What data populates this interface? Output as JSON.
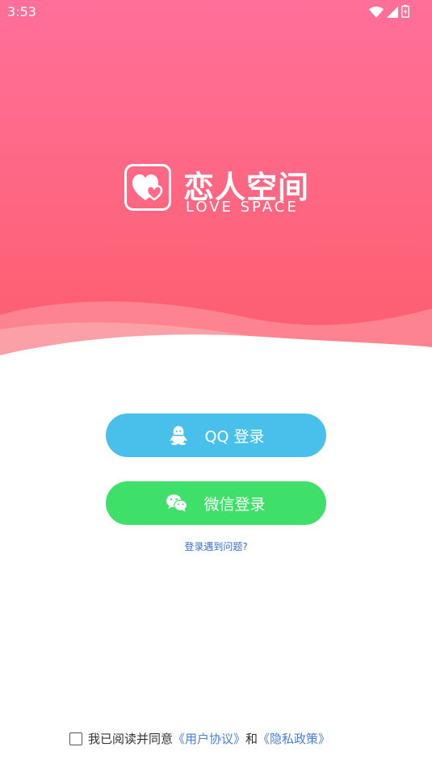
{
  "status_bar": {
    "time": "3:53",
    "icons": [
      "wifi-icon",
      "signal-icon",
      "battery-charging-icon"
    ]
  },
  "brand": {
    "name_cn": "恋人空间",
    "name_en": "LOVE SPACE",
    "logo_icon": "double-heart-icon"
  },
  "login": {
    "qq_label": "QQ 登录",
    "qq_icon": "qq-penguin-icon",
    "wechat_label": "微信登录",
    "wechat_icon": "wechat-icon",
    "help_link": "登录遇到问题?"
  },
  "agreement": {
    "checked": false,
    "prefix": "我已阅读并同意",
    "user_agreement": "《用户协议》",
    "conjunction": "和",
    "privacy_policy": "《隐私政策》"
  },
  "colors": {
    "hero_gradient_top": "#ff6f99",
    "hero_gradient_bottom": "#fc5d6f",
    "qq_button": "#49c0ec",
    "wechat_button": "#3ee069",
    "link": "#4a7fd6"
  }
}
